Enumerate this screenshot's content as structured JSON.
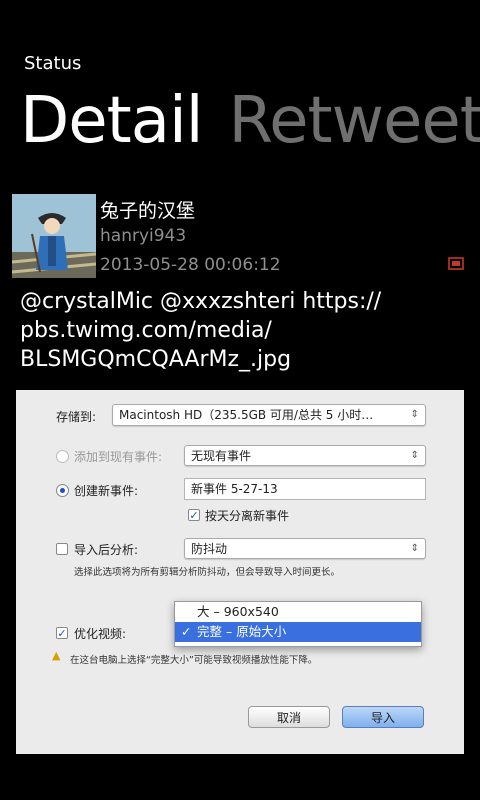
{
  "header": {
    "section": "Status",
    "tabs": [
      "Detail",
      "Retweet"
    ]
  },
  "tweet": {
    "name": "兔子的汉堡",
    "handle": "hanryi943",
    "timestamp": "2013-05-28   00:06:12",
    "text_lines": [
      "@crystalMic @xxxzshteri https://",
      "pbs.twimg.com/media/",
      "BLSMGQmCQAArMz_.jpg"
    ]
  },
  "attachment": {
    "save_to_label": "存储到:",
    "save_to_value": "Macintosh HD（235.5GB 可用/总共 5 小时…",
    "add_existing_label": "添加到现有事件:",
    "add_existing_value": "无现有事件",
    "new_event_label": "创建新事件:",
    "new_event_value": "新事件 5-27-13",
    "split_by_day_label": "按天分离新事件",
    "analyze_label": "导入后分析:",
    "analyze_value": "防抖动",
    "analyze_note": "选择此选项将为所有剪辑分析防抖动，但会导致导入时间更长。",
    "optimize_label": "优化视频:",
    "menu_options": [
      "大 – 960x540",
      "完整 – 原始大小"
    ],
    "warning_text": "在这台电脑上选择“完整大小”可能导致视频播放性能下降。",
    "cancel_label": "取消",
    "import_label": "导入"
  }
}
